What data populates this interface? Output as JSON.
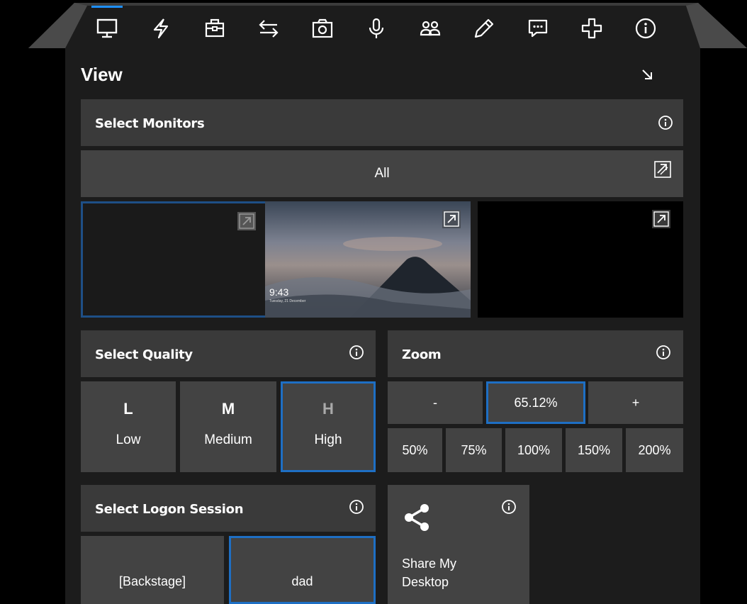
{
  "toolbar": {
    "active_index": 0,
    "items": [
      {
        "name": "monitor-icon"
      },
      {
        "name": "lightning-icon"
      },
      {
        "name": "toolbox-icon"
      },
      {
        "name": "transfer-arrows-icon"
      },
      {
        "name": "camera-icon"
      },
      {
        "name": "microphone-icon"
      },
      {
        "name": "users-icon"
      },
      {
        "name": "pencil-icon"
      },
      {
        "name": "chat-icon"
      },
      {
        "name": "plus-icon"
      },
      {
        "name": "info-icon"
      }
    ]
  },
  "panel": {
    "title": "View"
  },
  "monitors": {
    "header": "Select Monitors",
    "all_label": "All",
    "preview_time": "9:43",
    "preview_date": "Tuesday, 21 December",
    "items": [
      {
        "name": "monitor-1",
        "selected": true
      },
      {
        "name": "monitor-2",
        "selected": false
      },
      {
        "name": "monitor-3",
        "selected": false
      }
    ]
  },
  "quality": {
    "header": "Select Quality",
    "options": [
      {
        "letter": "L",
        "label": "Low",
        "selected": false
      },
      {
        "letter": "M",
        "label": "Medium",
        "selected": false
      },
      {
        "letter": "H",
        "label": "High",
        "selected": true
      }
    ]
  },
  "zoom": {
    "header": "Zoom",
    "minus_label": "-",
    "value": "65.12%",
    "plus_label": "+",
    "presets": [
      "50%",
      "75%",
      "100%",
      "150%",
      "200%"
    ]
  },
  "logon": {
    "header": "Select Logon Session",
    "sessions": [
      {
        "label": "[Backstage]",
        "selected": false
      },
      {
        "label": "dad",
        "selected": true
      }
    ]
  },
  "share": {
    "label_line1": "Share My",
    "label_line2": "Desktop"
  },
  "colors": {
    "accent": "#1e6fc4",
    "panel_bg": "#1c1c1c",
    "header_bg": "#3a3a3a",
    "button_bg": "#434343"
  }
}
